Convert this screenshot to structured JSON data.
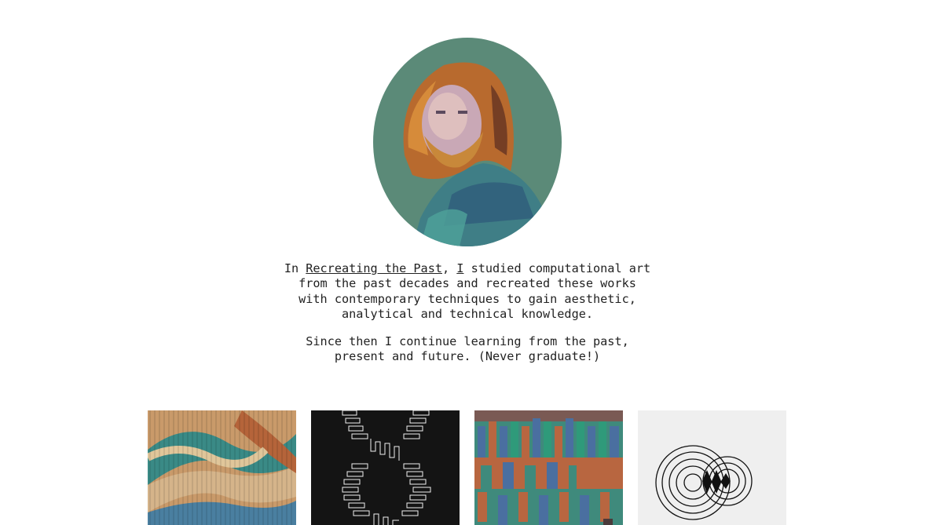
{
  "profile": {
    "portrait_icon": "painted-portrait-avatar",
    "background_color": "#5b8a78"
  },
  "intro": {
    "prefix": "In ",
    "link_label": "Recreating the Past",
    "comma": ", ",
    "link2_label": "I",
    "rest": " studied computational art from the past decades and recreated these works with contemporary techniques to gain aesthetic, analytical and technical knowledge."
  },
  "intro2": {
    "text": "Since then I continue learning from the past, present and future. (Never graduate!)"
  },
  "gallery": [
    {
      "icon": "wavy-stripes-artwork"
    },
    {
      "icon": "black-white-maze-artwork"
    },
    {
      "icon": "color-blocks-artwork"
    },
    {
      "icon": "concentric-circles-artwork"
    }
  ]
}
